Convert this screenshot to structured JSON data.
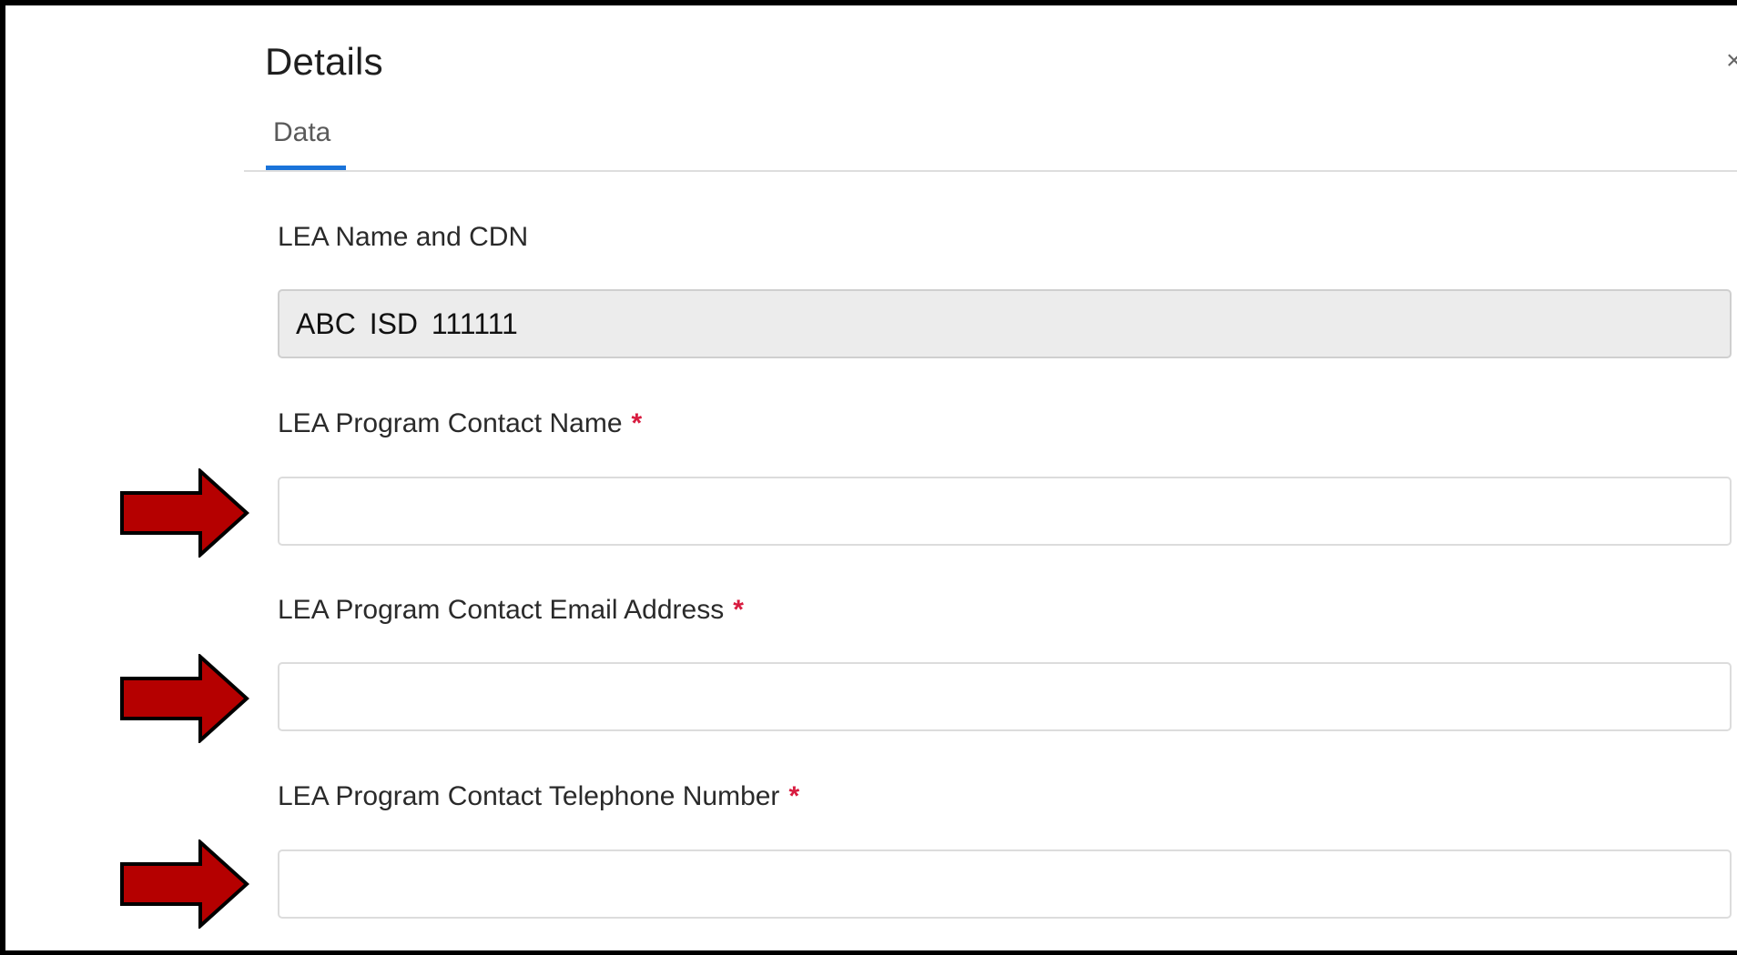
{
  "panel": {
    "title": "Details",
    "close_glyph": "×"
  },
  "tabs": [
    {
      "label": "Data",
      "active": true
    }
  ],
  "form": {
    "fields": [
      {
        "label": "LEA Name and CDN",
        "required": false,
        "value": "ABC ISD  111111",
        "readonly": true
      },
      {
        "label": "LEA Program Contact Name",
        "required": true,
        "value": "",
        "required_mark": "*"
      },
      {
        "label": "LEA Program Contact Email Address",
        "required": true,
        "value": "",
        "required_mark": "*"
      },
      {
        "label": "LEA Program Contact Telephone Number",
        "required": true,
        "value": "",
        "required_mark": "*"
      }
    ]
  },
  "annotations": {
    "arrow_icon": "right-arrow-icon",
    "arrow_color": "#b50000",
    "arrow_count": 3
  },
  "colors": {
    "accent": "#1a73d9",
    "required": "#d81b3f",
    "readonly_bg": "#ececec"
  }
}
